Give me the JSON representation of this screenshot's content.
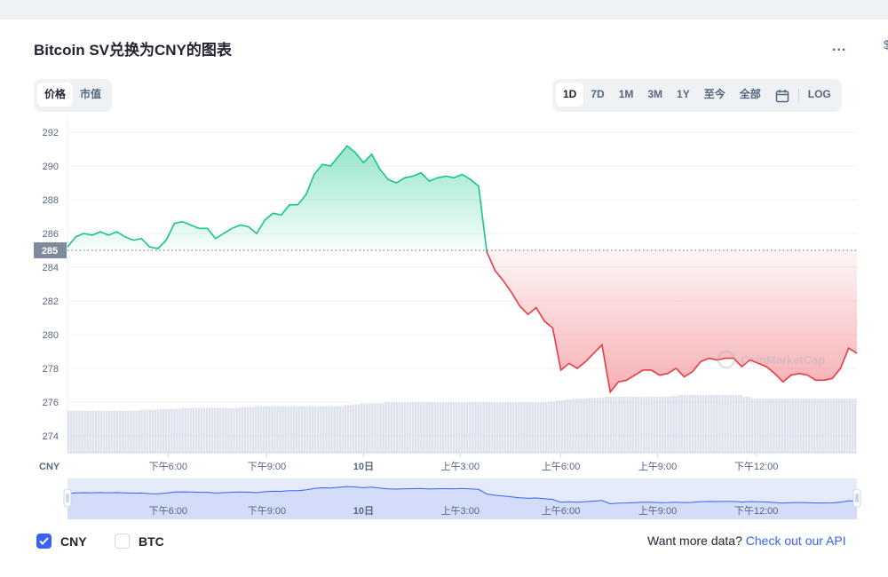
{
  "page": {
    "title": "Bitcoin SV兑换为CNY的图表",
    "more_label": "...",
    "edge_glyph": "$"
  },
  "view_tabs": [
    {
      "label": "价格",
      "active": true
    },
    {
      "label": "市值",
      "active": false
    }
  ],
  "range_tabs": [
    {
      "label": "1D",
      "active": true
    },
    {
      "label": "7D",
      "active": false
    },
    {
      "label": "1M",
      "active": false
    },
    {
      "label": "3M",
      "active": false
    },
    {
      "label": "1Y",
      "active": false
    },
    {
      "label": "至今",
      "active": false
    },
    {
      "label": "全部",
      "active": false
    }
  ],
  "calendar_icon": "calendar-icon",
  "log_label": "LOG",
  "chart_data": {
    "type": "area",
    "title": "",
    "ylabel": "",
    "y_ticks": [
      292,
      290,
      288,
      286,
      284,
      282,
      280,
      278,
      276,
      274
    ],
    "ylim": [
      273,
      293
    ],
    "x_ticks": [
      "下午6:00",
      "下午9:00",
      "10日",
      "上午3:00",
      "上午6:00",
      "上午9:00",
      "下午12:00"
    ],
    "x_tick_positions": [
      3.06,
      6.06,
      9.0,
      11.94,
      15.0,
      17.94,
      20.94
    ],
    "xlim": [
      0,
      24
    ],
    "currency_label": "CNY",
    "reference_value": 285,
    "reference_label": "285",
    "colors": {
      "up": "#16c784",
      "down": "#ea3943",
      "reference_label_bg": "#808a9d"
    },
    "watermark": "CoinMarketCap",
    "series": [
      {
        "x": [
          0,
          0.25,
          0.5,
          0.75,
          1.0,
          1.25,
          1.5,
          1.75,
          2.0,
          2.25,
          2.5,
          2.75,
          3.0,
          3.25,
          3.5,
          3.75,
          4.0,
          4.25,
          4.5,
          4.75,
          5.0,
          5.25,
          5.5,
          5.75,
          6.0,
          6.25,
          6.5,
          6.75,
          7.0,
          7.25,
          7.5,
          7.75,
          8.0,
          8.25,
          8.5,
          8.75,
          9.0,
          9.25,
          9.5,
          9.75,
          10.0,
          10.25,
          10.5,
          10.75,
          11.0,
          11.25,
          11.5,
          11.75,
          12.0,
          12.25,
          12.5,
          12.75,
          13.0,
          13.25,
          13.5,
          13.75,
          14.0,
          14.25,
          14.5,
          14.75,
          15.0,
          15.25,
          15.5,
          15.75,
          16.0,
          16.25,
          16.5,
          16.75,
          17.0,
          17.25,
          17.5,
          17.75,
          18.0,
          18.25,
          18.5,
          18.75,
          19.0,
          19.25,
          19.5,
          19.75,
          20.0,
          20.25,
          20.5,
          20.75,
          21.0,
          21.25,
          21.5,
          21.75,
          22.0,
          22.25,
          22.5,
          22.75,
          23.0,
          23.25,
          23.5,
          23.75,
          24.0
        ],
        "y": [
          285.2,
          285.8,
          286.0,
          285.9,
          286.1,
          285.9,
          286.1,
          285.8,
          285.6,
          285.7,
          285.2,
          285.1,
          285.6,
          286.6,
          286.7,
          286.5,
          286.3,
          286.3,
          285.7,
          286.0,
          286.3,
          286.5,
          286.4,
          286.0,
          286.8,
          287.2,
          287.1,
          287.7,
          287.7,
          288.3,
          289.5,
          290.1,
          290.0,
          290.6,
          291.2,
          290.8,
          290.2,
          290.7,
          289.8,
          289.2,
          289.0,
          289.3,
          289.4,
          289.6,
          289.1,
          289.3,
          289.4,
          289.3,
          289.5,
          289.2,
          288.8,
          284.9,
          283.8,
          283.2,
          282.5,
          281.7,
          281.2,
          281.6,
          280.8,
          280.4,
          277.9,
          278.3,
          278.0,
          278.4,
          278.9,
          279.4,
          276.6,
          277.2,
          277.3,
          277.6,
          277.9,
          277.9,
          277.6,
          277.7,
          278.0,
          277.5,
          277.8,
          278.4,
          278.6,
          278.5,
          278.6,
          278.6,
          278.1,
          278.5,
          278.3,
          278.1,
          277.7,
          277.2,
          277.6,
          277.7,
          277.6,
          277.3,
          277.3,
          277.4,
          278.0,
          279.2,
          278.9
        ],
        "volume": [
          0.45,
          0.45,
          0.45,
          0.45,
          0.45,
          0.45,
          0.45,
          0.45,
          0.45,
          0.46,
          0.46,
          0.47,
          0.47,
          0.47,
          0.48,
          0.48,
          0.48,
          0.48,
          0.48,
          0.48,
          0.48,
          0.49,
          0.49,
          0.5,
          0.5,
          0.5,
          0.5,
          0.5,
          0.5,
          0.5,
          0.5,
          0.5,
          0.5,
          0.5,
          0.51,
          0.52,
          0.53,
          0.53,
          0.53,
          0.54,
          0.54,
          0.54,
          0.54,
          0.54,
          0.54,
          0.54,
          0.54,
          0.54,
          0.54,
          0.54,
          0.54,
          0.54,
          0.54,
          0.54,
          0.54,
          0.54,
          0.54,
          0.54,
          0.54,
          0.55,
          0.56,
          0.57,
          0.58,
          0.58,
          0.59,
          0.59,
          0.6,
          0.6,
          0.6,
          0.6,
          0.6,
          0.6,
          0.6,
          0.6,
          0.61,
          0.62,
          0.62,
          0.62,
          0.62,
          0.62,
          0.62,
          0.62,
          0.62,
          0.6,
          0.58,
          0.58,
          0.58,
          0.58,
          0.58,
          0.58,
          0.58,
          0.58,
          0.58,
          0.58,
          0.58,
          0.58,
          0.58
        ]
      }
    ]
  },
  "navigator": {
    "x_ticks": [
      "下午6:00",
      "下午9:00",
      "10日",
      "上午3:00",
      "上午6:00",
      "上午9:00",
      "下午12:00"
    ]
  },
  "legend": [
    {
      "label": "CNY",
      "checked": true
    },
    {
      "label": "BTC",
      "checked": false
    }
  ],
  "footer": {
    "prompt": "Want more data?",
    "link": "Check out our API"
  }
}
